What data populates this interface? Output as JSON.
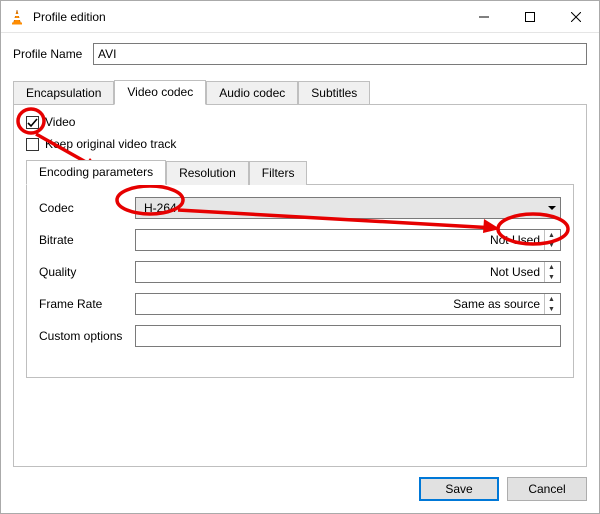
{
  "window": {
    "title": "Profile edition"
  },
  "profile": {
    "name_label": "Profile Name",
    "name_value": "AVI"
  },
  "tabs": {
    "encapsulation": "Encapsulation",
    "video_codec": "Video codec",
    "audio_codec": "Audio codec",
    "subtitles": "Subtitles"
  },
  "video": {
    "enable_label": "Video",
    "enable_checked": true,
    "keep_original_label": "Keep original video track",
    "keep_original_checked": false
  },
  "sub_tabs": {
    "encoding": "Encoding parameters",
    "resolution": "Resolution",
    "filters": "Filters"
  },
  "form": {
    "codec_label": "Codec",
    "codec_value": "H-264",
    "bitrate_label": "Bitrate",
    "bitrate_value": "Not Used",
    "quality_label": "Quality",
    "quality_value": "Not Used",
    "framerate_label": "Frame Rate",
    "framerate_value": "Same as source",
    "custom_label": "Custom options",
    "custom_value": ""
  },
  "footer": {
    "save": "Save",
    "cancel": "Cancel"
  }
}
